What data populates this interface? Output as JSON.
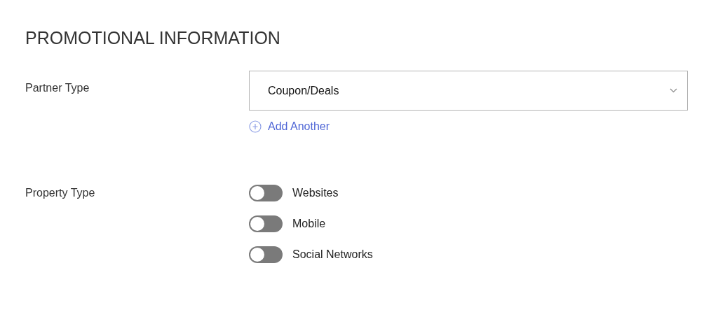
{
  "section": {
    "title": "PROMOTIONAL INFORMATION"
  },
  "partner_type": {
    "label": "Partner Type",
    "value": "Coupon/Deals",
    "add_link": "Add Another"
  },
  "property_type": {
    "label": "Property Type",
    "options": [
      {
        "label": "Websites",
        "on": false
      },
      {
        "label": "Mobile",
        "on": false
      },
      {
        "label": "Social Networks",
        "on": false
      }
    ]
  }
}
